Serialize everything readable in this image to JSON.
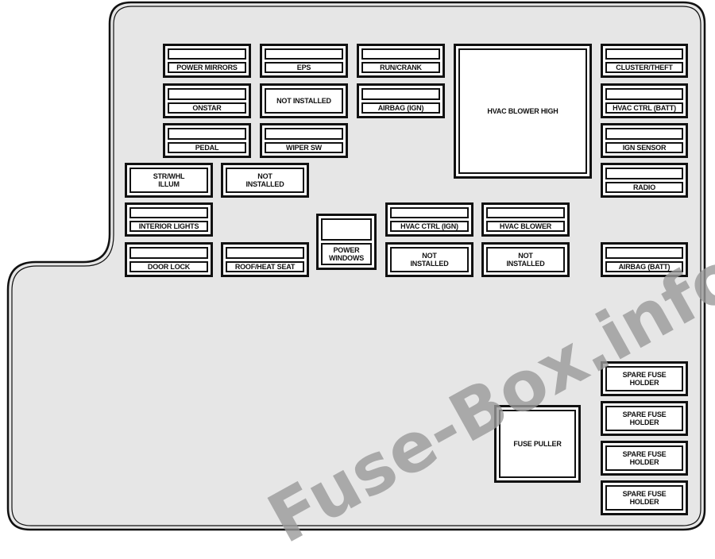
{
  "fuses": [
    {
      "label": "POWER MIRRORS",
      "type": "split"
    },
    {
      "label": "EPS",
      "type": "split"
    },
    {
      "label": "RUN/CRANK",
      "type": "split"
    },
    {
      "label": "ONSTAR",
      "type": "split"
    },
    {
      "label": "NOT INSTALLED",
      "type": "single"
    },
    {
      "label": "AIRBAG (IGN)",
      "type": "split"
    },
    {
      "label": "PEDAL",
      "type": "split"
    },
    {
      "label": "WIPER SW",
      "type": "split"
    },
    {
      "label": "HVAC BLOWER HIGH",
      "type": "single"
    },
    {
      "label": "CLUSTER/THEFT",
      "type": "split"
    },
    {
      "label": "HVAC CTRL (BATT)",
      "type": "split"
    },
    {
      "label": "IGN SENSOR",
      "type": "split"
    },
    {
      "label": "RADIO",
      "type": "split"
    },
    {
      "label": "STR/WHL\nILLUM",
      "type": "single"
    },
    {
      "label": "NOT\nINSTALLED",
      "type": "single"
    },
    {
      "label": "INTERIOR LIGHTS",
      "type": "split"
    },
    {
      "label": "DOOR LOCK",
      "type": "split"
    },
    {
      "label": "ROOF/HEAT SEAT",
      "type": "split"
    },
    {
      "label": "POWER\nWINDOWS",
      "type": "split"
    },
    {
      "label": "HVAC CTRL (IGN)",
      "type": "split"
    },
    {
      "label": "HVAC BLOWER",
      "type": "split"
    },
    {
      "label": "NOT\nINSTALLED",
      "type": "single"
    },
    {
      "label": "NOT\nINSTALLED",
      "type": "single"
    },
    {
      "label": "AIRBAG (BATT)",
      "type": "split"
    },
    {
      "label": "SPARE FUSE\nHOLDER",
      "type": "single"
    },
    {
      "label": "SPARE FUSE\nHOLDER",
      "type": "single"
    },
    {
      "label": "SPARE FUSE\nHOLDER",
      "type": "single"
    },
    {
      "label": "SPARE FUSE\nHOLDER",
      "type": "single"
    },
    {
      "label": "FUSE PULLER",
      "type": "single"
    }
  ],
  "watermark": "Fuse-Box.info",
  "colors": {
    "panel": "#e6e6e6",
    "outline": "#111111",
    "watermark": "#9a9a9a"
  }
}
